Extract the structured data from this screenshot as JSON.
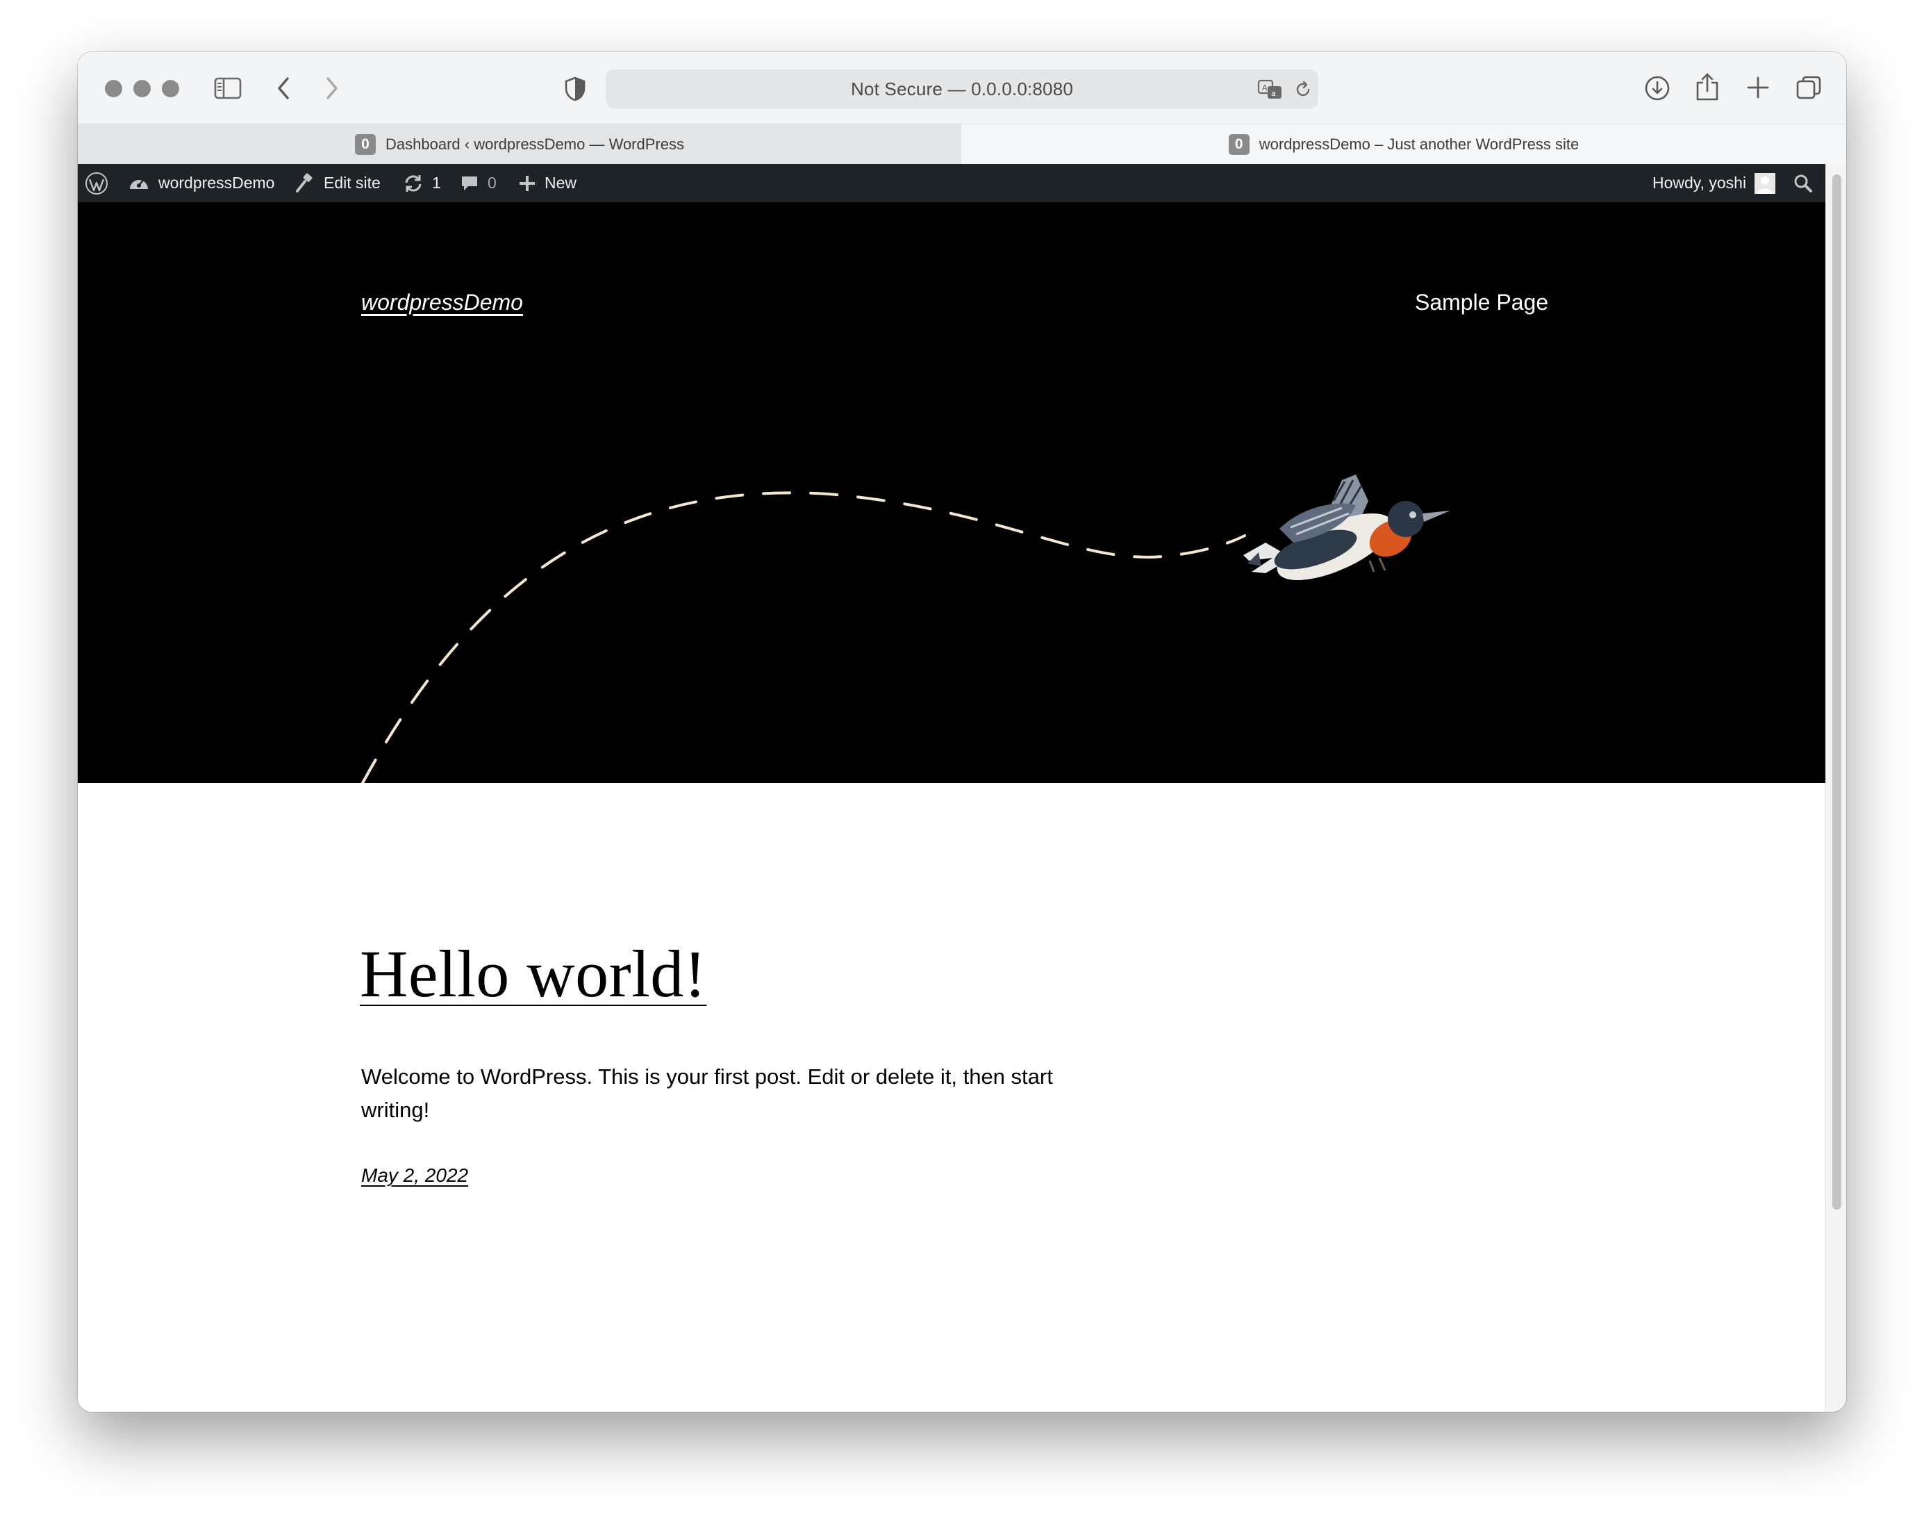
{
  "browser": {
    "address": "Not Secure — 0.0.0.0:8080",
    "tabs": [
      {
        "favicon": "0",
        "title": "Dashboard ‹ wordpressDemo — WordPress",
        "active": false
      },
      {
        "favicon": "0",
        "title": "wordpressDemo – Just another WordPress site",
        "active": true
      }
    ]
  },
  "adminbar": {
    "site_name": "wordpressDemo",
    "edit_site": "Edit site",
    "updates_count": "1",
    "comments_count": "0",
    "new_label": "New",
    "greeting": "Howdy, yoshi"
  },
  "site": {
    "title": "wordpressDemo",
    "nav": [
      "Sample Page"
    ]
  },
  "post": {
    "title": "Hello world!",
    "excerpt": "Welcome to WordPress. This is your first post. Edit or delete it, then start writing!",
    "date": "May 2, 2022"
  },
  "colors": {
    "hero_bg": "#000000",
    "adminbar_bg": "#1d2327",
    "flight_path": "#f5e6cf"
  }
}
